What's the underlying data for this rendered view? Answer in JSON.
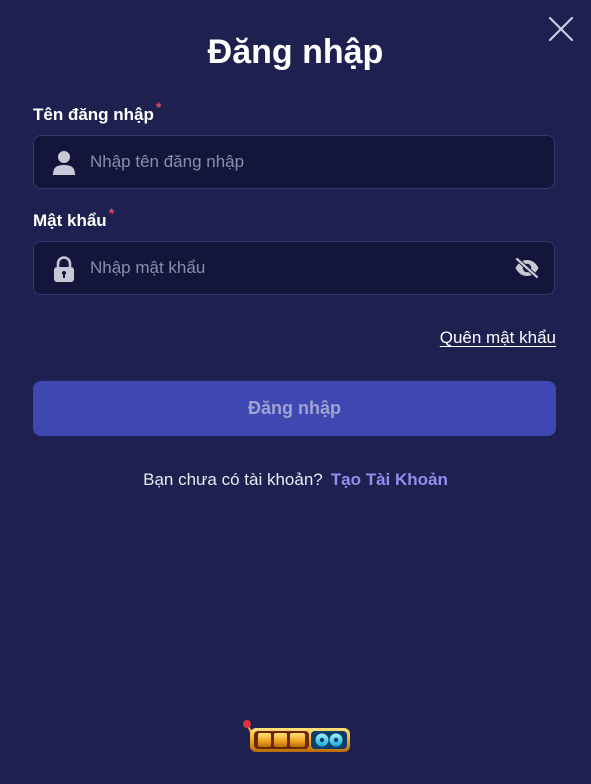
{
  "modal": {
    "title": "Đăng nhập"
  },
  "form": {
    "username": {
      "label": "Tên đăng nhập",
      "required_mark": "*",
      "placeholder": "Nhập tên đăng nhập",
      "value": ""
    },
    "password": {
      "label": "Mật khẩu",
      "required_mark": "*",
      "placeholder": "Nhập mật khẩu",
      "value": ""
    },
    "forgot_label": "Quên mật khẩu",
    "submit_label": "Đăng nhập"
  },
  "signup": {
    "prompt": "Bạn chưa có tài khoản?",
    "link_label": "Tạo Tài Khoản"
  },
  "icons": {
    "close": "close-icon",
    "user": "user-icon",
    "lock": "lock-icon",
    "eye": "eye-off-icon"
  },
  "colors": {
    "background": "#1e2150",
    "input_bg": "#13163a",
    "button_bg": "#3f47b0",
    "link_accent": "#8f8ff0",
    "required": "#e24a6a"
  }
}
